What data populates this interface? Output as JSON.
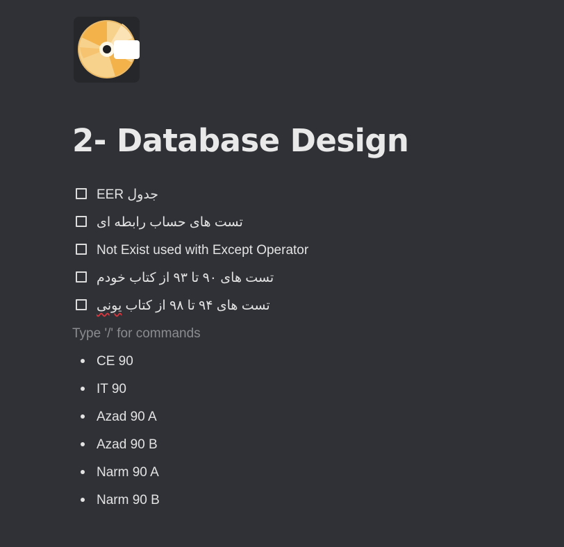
{
  "page": {
    "icon": "cd-disc-icon",
    "title": "2- Database Design"
  },
  "todos": [
    {
      "label": "جدول EER",
      "checked": false
    },
    {
      "label": "تست های حساب رابطه ای",
      "checked": false
    },
    {
      "label": "Not Exist used with Except Operator",
      "checked": false
    },
    {
      "label": "تست های ۹۰ تا ۹۳ از کتاب خودم",
      "checked": false
    },
    {
      "label_start": "تست های ۹۴ تا ۹۸ از کتاب ",
      "label_typo": "یونی",
      "checked": false
    }
  ],
  "placeholder": "Type '/' for commands",
  "bullets": [
    {
      "label": "CE 90"
    },
    {
      "label": "IT 90"
    },
    {
      "label": "Azad 90 A"
    },
    {
      "label": "Azad 90 B"
    },
    {
      "label": "Narm 90 A"
    },
    {
      "label": "Narm 90 B"
    }
  ],
  "colors": {
    "background": "#2f3136",
    "text": "#e3e3e3",
    "placeholder": "#8a8c90",
    "spellcheck": "#d9363e"
  }
}
